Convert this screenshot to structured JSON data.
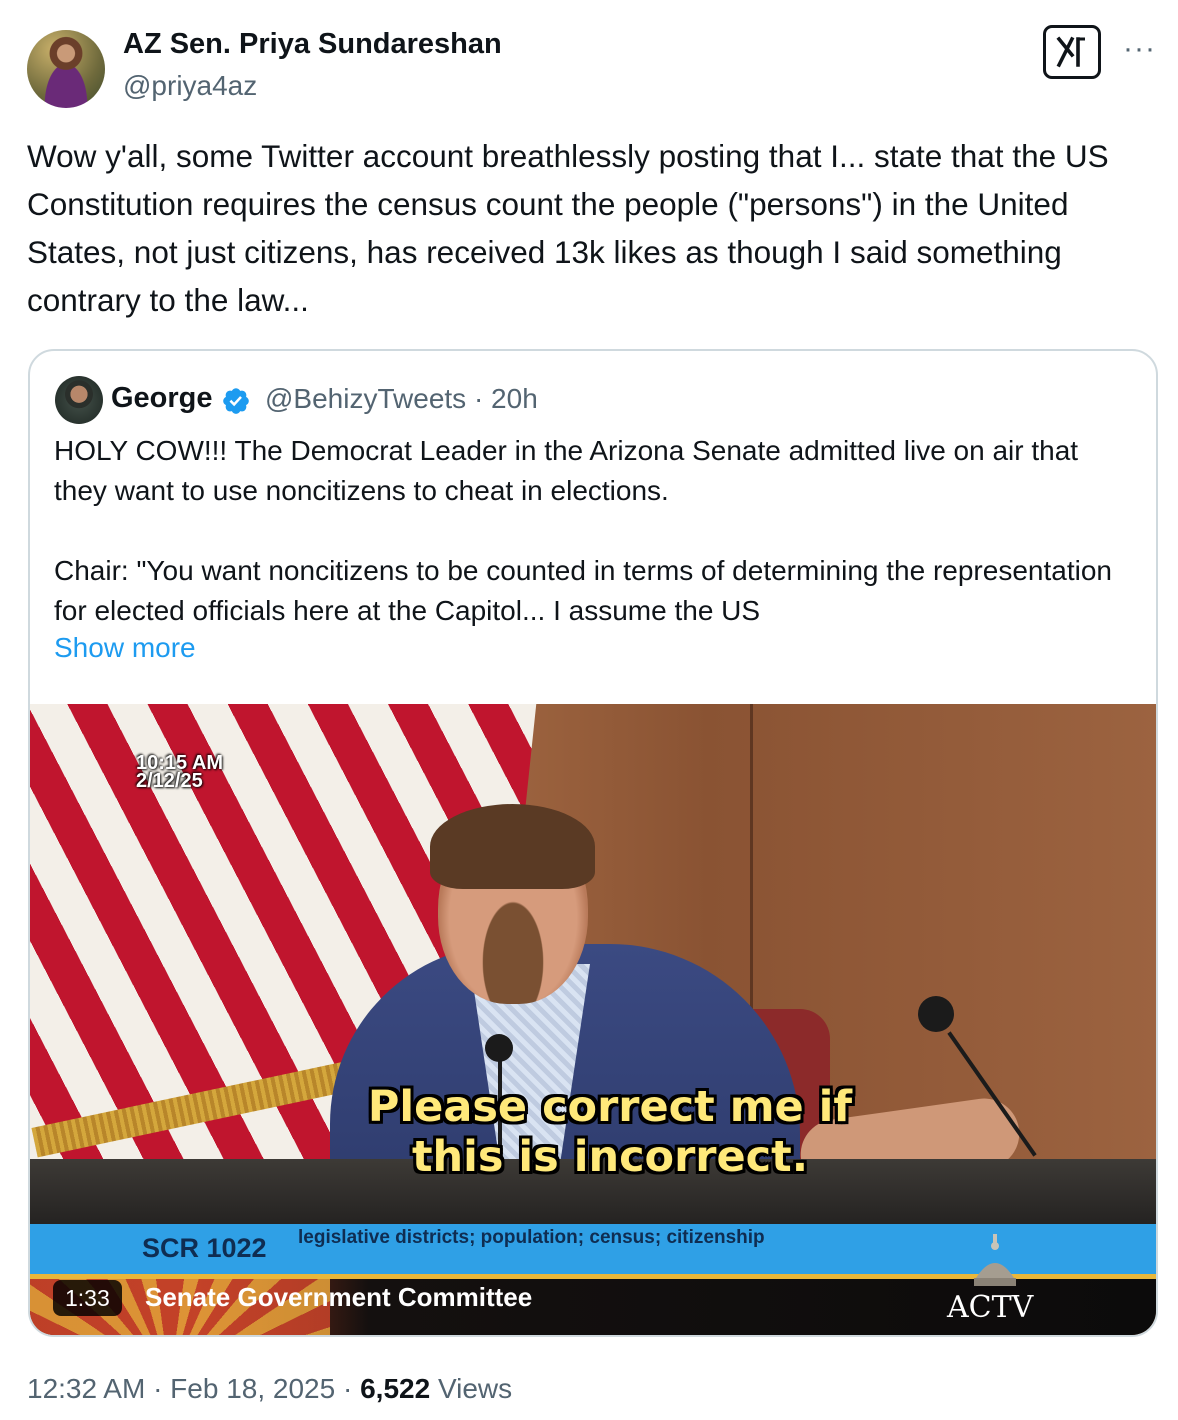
{
  "author": {
    "name": "AZ Sen. Priya Sundareshan",
    "handle": "@priya4az",
    "avatar_icon": "profile-photo"
  },
  "actions": {
    "grok_icon": "grok-icon",
    "more_icon": "more-horizontal-icon",
    "more_label": "···"
  },
  "tweet": {
    "text": "Wow y'all, some Twitter account breathlessly posting that I... state that the US Constitution requires the census count the people (\"persons\") in the United States, not just citizens, has received 13k likes as though I said something contrary to the law..."
  },
  "quote": {
    "name": "George",
    "verified_icon": "verified-badge-icon",
    "handle_time": "@BehizyTweets · 20h",
    "paragraph1": "HOLY COW!!! The Democrat Leader in the Arizona Senate admitted live on air that they want to use noncitizens to cheat in elections.",
    "paragraph2": "Chair: \"You want noncitizens to be counted in terms of determining the representation for elected officials here at the Capitol... I assume the US",
    "show_more": "Show more",
    "video": {
      "timestamp_time": "10:15 AM",
      "timestamp_date": "2/12/25",
      "caption_line1": "Please correct me if",
      "caption_line2": "this is incorrect.",
      "bill_code": "SCR 1022",
      "bill_description": "legislative districts; population; census; citizenship",
      "committee": "Senate Government Committee",
      "network": "ACTV",
      "duration": "1:33"
    }
  },
  "footer": {
    "time_date": "12:32 AM · Feb 18, 2025 · ",
    "views_count": "6,522",
    "views_label": " Views"
  },
  "colors": {
    "text": "#0f1419",
    "secondary": "#536471",
    "link": "#1d9bf0",
    "border": "#cfd9de",
    "verified": "#1d9bf0",
    "lower_third_blue": "#2fa0e6"
  }
}
